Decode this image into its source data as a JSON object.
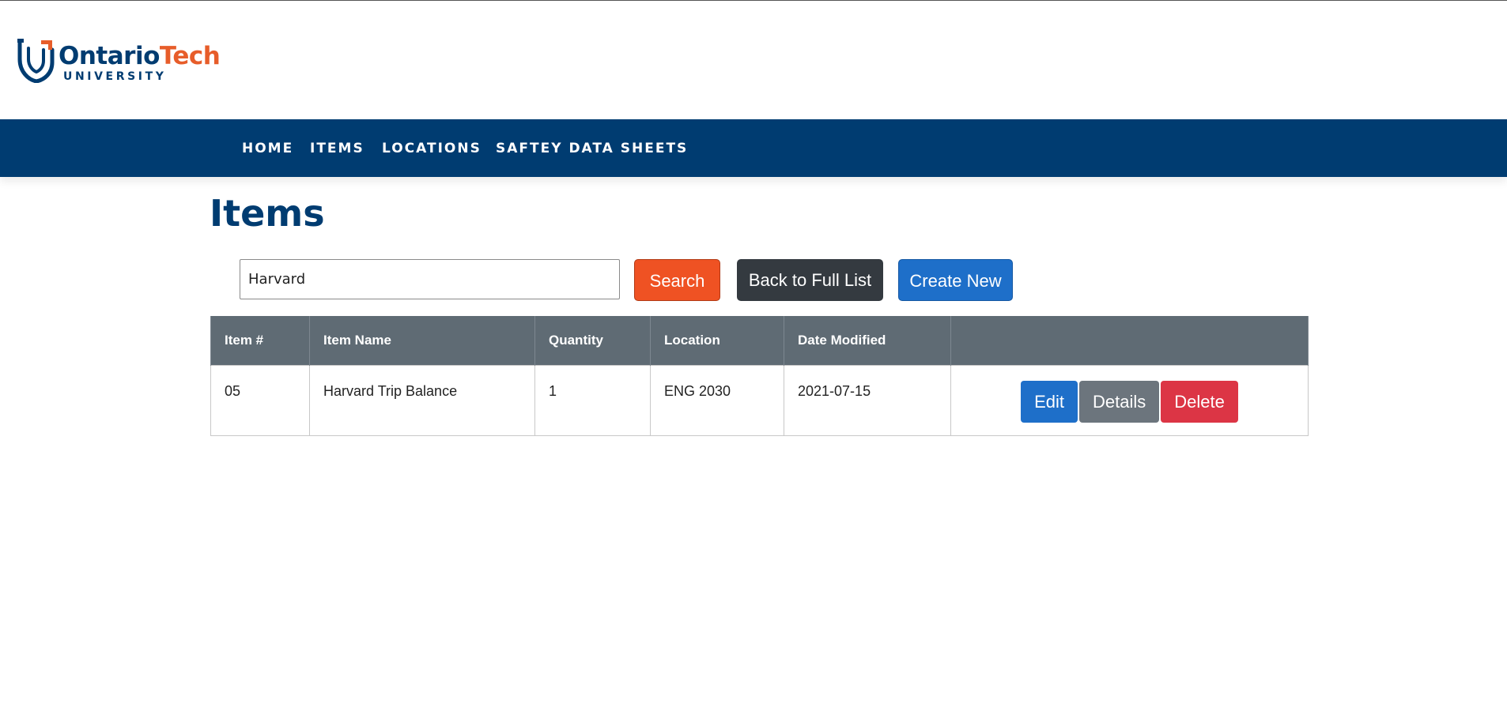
{
  "brand": {
    "logo_main_a": "Ontario",
    "logo_main_b": "Tech",
    "logo_sub": "UNIVERSITY",
    "colors": {
      "navy": "#003c71",
      "orange": "#e75d2a"
    }
  },
  "nav": {
    "items": [
      {
        "label": "HOME"
      },
      {
        "label": "ITEMS"
      },
      {
        "label": "LOCATIONS"
      },
      {
        "label": "SAFTEY DATA SHEETS"
      }
    ]
  },
  "page": {
    "title": "Items"
  },
  "search": {
    "value": "Harvard",
    "search_label": "Search",
    "back_label": "Back to Full List",
    "create_label": "Create New"
  },
  "table": {
    "headers": [
      "Item #",
      "Item Name",
      "Quantity",
      "Location",
      "Date Modified",
      ""
    ],
    "rows": [
      {
        "item_no": "05",
        "name": "Harvard Trip Balance",
        "quantity": "1",
        "location": "ENG 2030",
        "date_modified": "2021-07-15",
        "edit_label": "Edit",
        "details_label": "Details",
        "delete_label": "Delete"
      }
    ]
  }
}
